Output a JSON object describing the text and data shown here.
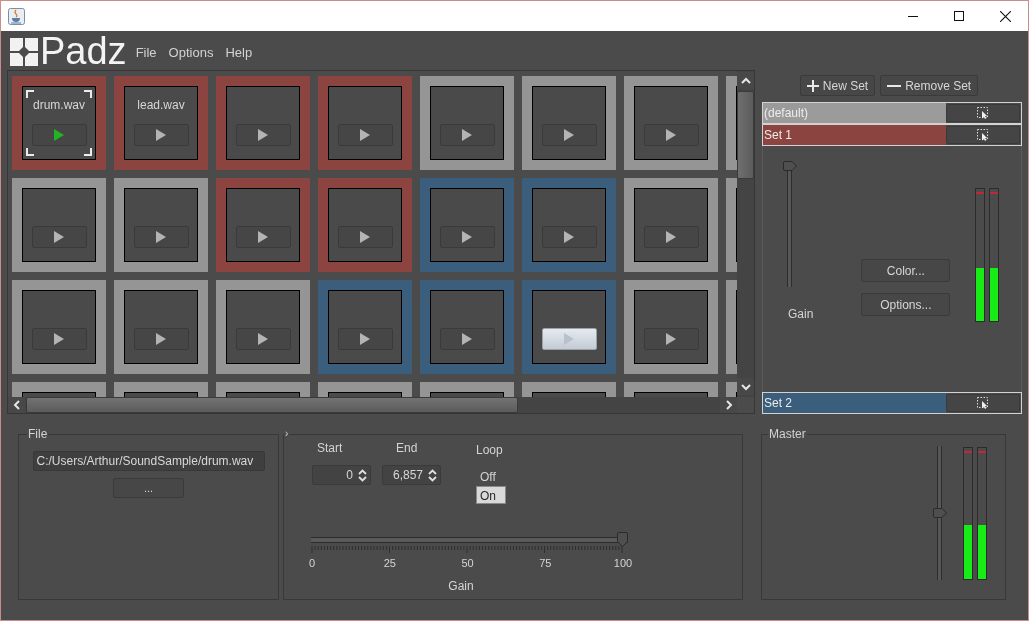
{
  "app": {
    "name": "Padz"
  },
  "menu": [
    {
      "label": "File"
    },
    {
      "label": "Options"
    },
    {
      "label": "Help"
    }
  ],
  "pad_rows": [
    [
      {
        "label": "drum.wav",
        "color": "#8b443f",
        "selected": true,
        "playing": true,
        "pressed": false
      },
      {
        "label": "lead.wav",
        "color": "#8b443f",
        "selected": false,
        "playing": false,
        "pressed": false
      },
      {
        "color": "#8b443f",
        "selected": false,
        "playing": false,
        "pressed": false
      },
      {
        "color": "#8b443f",
        "selected": false,
        "playing": false,
        "pressed": false
      },
      {
        "color": "#959595",
        "selected": false,
        "playing": false,
        "pressed": false
      },
      {
        "color": "#959595",
        "selected": false,
        "playing": false,
        "pressed": false
      },
      {
        "color": "#959595",
        "selected": false,
        "playing": false,
        "pressed": false
      },
      {
        "color": "#959595"
      }
    ],
    [
      {
        "color": "#959595",
        "selected": false,
        "playing": false,
        "pressed": false
      },
      {
        "color": "#959595",
        "selected": false,
        "playing": false,
        "pressed": false
      },
      {
        "color": "#8b443f",
        "selected": false,
        "playing": false,
        "pressed": false
      },
      {
        "color": "#8b443f",
        "selected": false,
        "playing": false,
        "pressed": false
      },
      {
        "color": "#3a5e7b",
        "selected": false,
        "playing": false,
        "pressed": false
      },
      {
        "color": "#3a5e7b",
        "selected": false,
        "playing": false,
        "pressed": false
      },
      {
        "color": "#959595",
        "selected": false,
        "playing": false,
        "pressed": false
      },
      {
        "color": "#959595"
      }
    ],
    [
      {
        "color": "#959595",
        "selected": false,
        "playing": false,
        "pressed": false
      },
      {
        "color": "#959595",
        "selected": false,
        "playing": false,
        "pressed": false
      },
      {
        "color": "#959595",
        "selected": false,
        "playing": false,
        "pressed": false
      },
      {
        "color": "#3a5e7b",
        "selected": false,
        "playing": false,
        "pressed": false
      },
      {
        "color": "#3a5e7b",
        "selected": false,
        "playing": false,
        "pressed": false
      },
      {
        "color": "#3a5e7b",
        "selected": false,
        "playing": false,
        "pressed": true
      },
      {
        "color": "#959595",
        "selected": false,
        "playing": false,
        "pressed": false
      },
      {
        "color": "#959595"
      }
    ],
    [
      {
        "color": "#959595"
      },
      {
        "color": "#959595"
      },
      {
        "color": "#959595"
      },
      {
        "color": "#959595"
      },
      {
        "color": "#959595"
      },
      {
        "color": "#959595"
      },
      {
        "color": "#959595"
      },
      {
        "color": "#959595"
      }
    ]
  ],
  "set_toolbar": [
    {
      "kind": "add",
      "label": "New Set"
    },
    {
      "kind": "remove",
      "label": "Remove Set"
    }
  ],
  "sets": [
    {
      "name": "(default)",
      "color": "#9b9b9b",
      "expanded": false
    },
    {
      "name": "Set 1",
      "color": "#8b443f",
      "expanded": true,
      "gain": {
        "label": "Gain",
        "level": 1
      },
      "buttons": [
        "Color...",
        "Options..."
      ],
      "meters": [
        {
          "level": 0.4
        },
        {
          "level": 0.4
        }
      ]
    },
    {
      "name": "Set 2",
      "color": "#3a5e7b",
      "expanded": false
    }
  ],
  "file_panel": {
    "title": "File",
    "path": "C:/Users/Arthur/SoundSample/drum.wav",
    "browse_button": "..."
  },
  "sample_panel": {
    "title": "›",
    "start": {
      "label": "Start",
      "value": "0"
    },
    "end": {
      "label": "End",
      "value": "6,857"
    },
    "loop": {
      "label": "Loop",
      "options": [
        {
          "label": "Off",
          "selected": false
        },
        {
          "label": "On",
          "selected": true
        }
      ]
    },
    "gain": {
      "label": "Gain",
      "level": 1,
      "tick_labels": [
        "0",
        "25",
        "50",
        "75",
        "100"
      ]
    }
  },
  "master_panel": {
    "title": "Master",
    "gain": {
      "level": 0.5
    },
    "meters": [
      {
        "level": 0.41
      },
      {
        "level": 0.41
      }
    ]
  }
}
